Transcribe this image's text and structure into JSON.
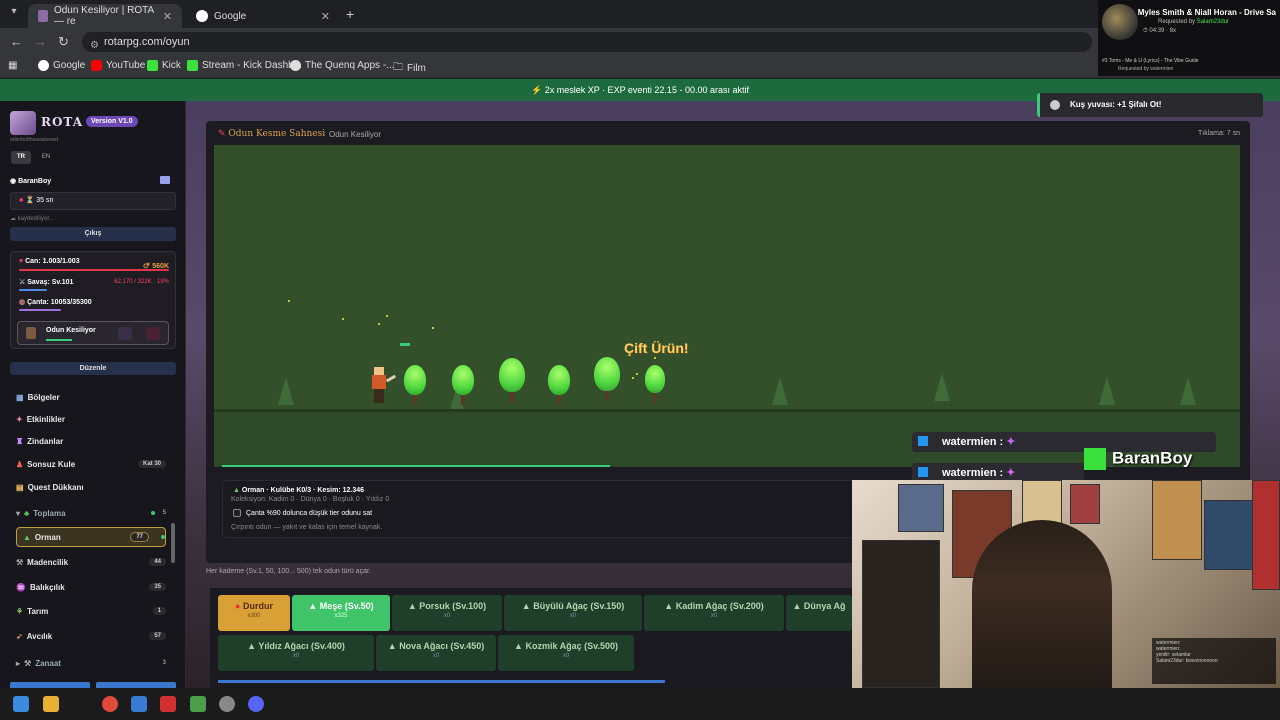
{
  "browser": {
    "tabs": [
      {
        "title": "Odun Kesiliyor | ROTA — re",
        "active": true
      },
      {
        "title": "Google",
        "active": false
      }
    ],
    "url": "rotarpg.com/oyun",
    "bookmarks": [
      "Google",
      "YouTube",
      "Kick",
      "Stream - Kick Dashb...",
      "The Quenq Apps -...",
      "Film"
    ]
  },
  "music": {
    "song": "Myles Smith & Niall Horan - Drive Sa",
    "requested_by": "Requested by",
    "requester": "Salam23dur",
    "time": "04:39",
    "plays": "8x",
    "next_song": "Toms - Me & U (Lyrics) - The Vibe Guide",
    "next_requested": "Requested by watermien"
  },
  "banner": "⚡ 2x meslek XP · EXP eventi 22.15 - 00.00 arası aktif",
  "sidebar": {
    "brand": "ROTA",
    "version": "Version V1.0",
    "tagline": "rebirthoftheawakened",
    "lang_tr": "TR",
    "lang_en": "EN",
    "username": "BaranBoy",
    "timer": "⏳ 35 sn",
    "saving": "kaydediliyor...",
    "logout": "Çıkış",
    "hp": "Can: 1.003/1.003",
    "gold": "560K",
    "combat": "Savaş: Sv.101",
    "combat_xp": "62.170 / 322K · 19%",
    "bag": "Çanta: 10053/35300",
    "activity": "Odun Kesiliyor",
    "edit": "Düzenle",
    "menu": [
      {
        "label": "Bölgeler",
        "count": ""
      },
      {
        "label": "Etkinlikler",
        "count": ""
      },
      {
        "label": "Zindanlar",
        "count": ""
      },
      {
        "label": "Sonsuz Kule",
        "count": "Kat 30"
      },
      {
        "label": "Quest Dükkanı",
        "count": ""
      },
      {
        "label": "Toplama",
        "count": "5"
      },
      {
        "label": "Orman",
        "count": "77"
      },
      {
        "label": "Madencilik",
        "count": "44"
      },
      {
        "label": "Balıkçılık",
        "count": "35"
      },
      {
        "label": "Tarım",
        "count": "1"
      },
      {
        "label": "Avcılık",
        "count": "57"
      },
      {
        "label": "Zanaat",
        "count": "3"
      }
    ]
  },
  "game": {
    "title": "Odun Kesme Sahnesi",
    "subtitle": "Odun Kesiliyor",
    "click_info": "Tıklama: 7 sn",
    "float_text": "Çift Ürün!",
    "info_line1": "Orman · Kulübe K0/3 · Kesim: 12.346",
    "info_line2": "Koleksiyon: Kadim 0 · Dünya 0 · Boşluk 0 · Yıldız 0",
    "info_checkbox": "Çanta %90 dolunca düşük tier odunu sat",
    "info_desc": "Çırpıntı odun — yakıt ve kalas için temel kaynak.",
    "hint": "Her kademe (Sv.1, 50, 100... 500) tek odun türü açar.",
    "tiers": [
      {
        "name": "Durdur",
        "sub": "x300"
      },
      {
        "name": "Meşe (Sv.50)",
        "sub": "x325"
      },
      {
        "name": "Porsuk (Sv.100)",
        "sub": "x0"
      },
      {
        "name": "Büyülü Ağaç (Sv.150)",
        "sub": "x0"
      },
      {
        "name": "Kadim Ağaç (Sv.200)",
        "sub": "x0"
      },
      {
        "name": "Dünya Ağ",
        "sub": ""
      },
      {
        "name": "Yıldız Ağacı (Sv.400)",
        "sub": "x0"
      },
      {
        "name": "Nova Ağacı (Sv.450)",
        "sub": "x0"
      },
      {
        "name": "Kozmik Ağaç (Sv.500)",
        "sub": "x0"
      }
    ]
  },
  "toast": "Kuş yuvası: +1 Şifalı Ot!",
  "stream": {
    "chat1": "watermien :",
    "chat2": "watermien :",
    "channel": "BaranBoy",
    "chat_lines": [
      "watermien:",
      "watermien:",
      "yenilir: selamlar",
      "Salam23dur: bravoooooooo"
    ]
  },
  "colors": {
    "accent": "#6e48b4",
    "banner": "#1c6a3d",
    "selected_tier": "#3fc46a",
    "stop_tier": "#d8a035"
  }
}
